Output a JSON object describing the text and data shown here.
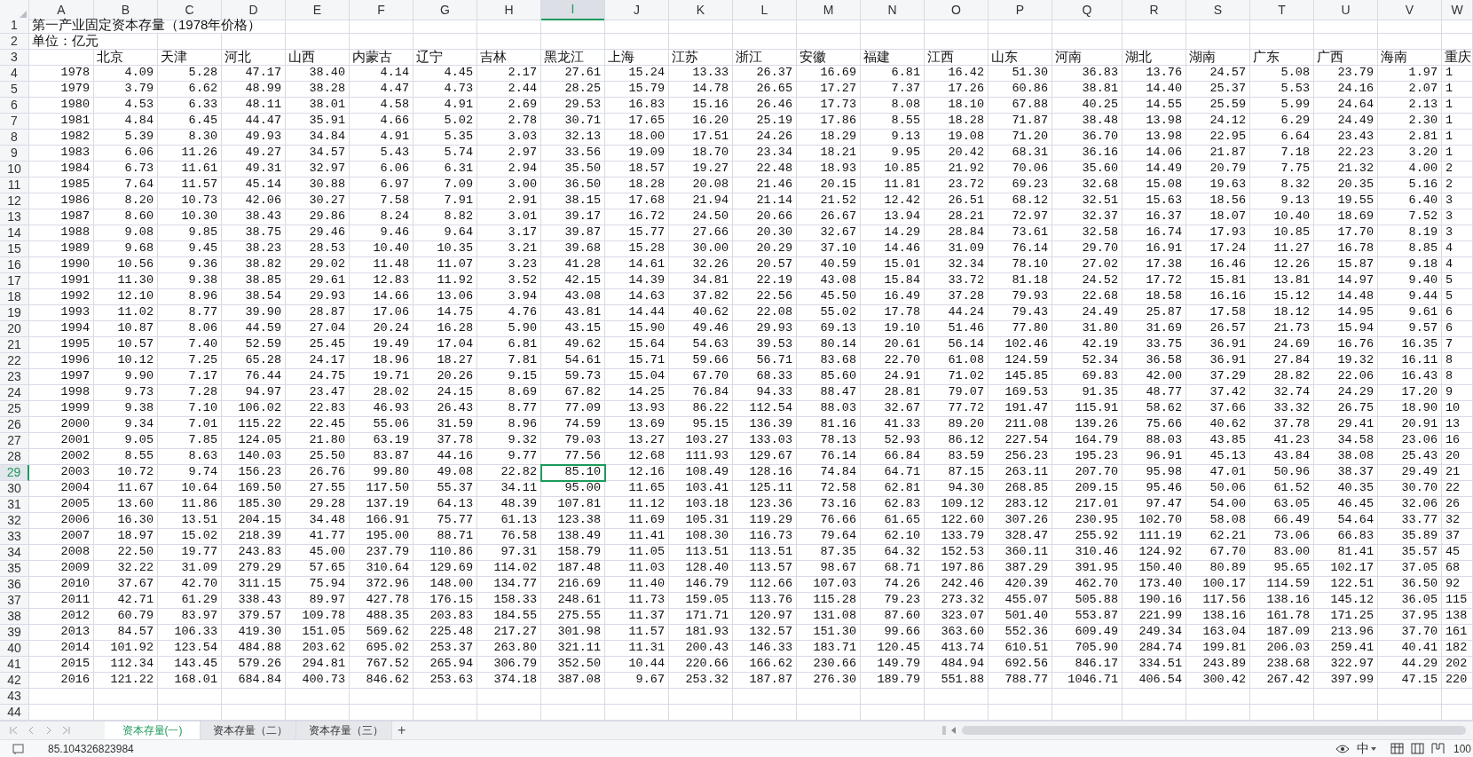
{
  "sheet": {
    "title": "第一产业固定资本存量（1978年价格）",
    "unit": "单位：亿元",
    "columns": [
      {
        "label": "A",
        "selected": false
      },
      {
        "label": "B",
        "selected": false
      },
      {
        "label": "C",
        "selected": false
      },
      {
        "label": "D",
        "selected": false
      },
      {
        "label": "E",
        "selected": false
      },
      {
        "label": "F",
        "selected": false
      },
      {
        "label": "G",
        "selected": false
      },
      {
        "label": "H",
        "selected": false
      },
      {
        "label": "I",
        "selected": true
      },
      {
        "label": "J",
        "selected": false
      },
      {
        "label": "K",
        "selected": false
      },
      {
        "label": "L",
        "selected": false
      },
      {
        "label": "M",
        "selected": false
      },
      {
        "label": "N",
        "selected": false
      },
      {
        "label": "O",
        "selected": false
      },
      {
        "label": "P",
        "selected": false
      },
      {
        "label": "Q",
        "selected": false
      },
      {
        "label": "R",
        "selected": false
      },
      {
        "label": "S",
        "selected": false
      },
      {
        "label": "T",
        "selected": false
      },
      {
        "label": "U",
        "selected": false
      },
      {
        "label": "V",
        "selected": false
      },
      {
        "label": "W",
        "selected": false
      }
    ],
    "row_headers": [
      {
        "label": "1",
        "selected": false
      },
      {
        "label": "2",
        "selected": false
      },
      {
        "label": "3",
        "selected": false
      },
      {
        "label": "4",
        "selected": false
      },
      {
        "label": "5",
        "selected": false
      },
      {
        "label": "6",
        "selected": false
      },
      {
        "label": "7",
        "selected": false
      },
      {
        "label": "8",
        "selected": false
      },
      {
        "label": "9",
        "selected": false
      },
      {
        "label": "10",
        "selected": false
      },
      {
        "label": "11",
        "selected": false
      },
      {
        "label": "12",
        "selected": false
      },
      {
        "label": "13",
        "selected": false
      },
      {
        "label": "14",
        "selected": false
      },
      {
        "label": "15",
        "selected": false
      },
      {
        "label": "16",
        "selected": false
      },
      {
        "label": "17",
        "selected": false
      },
      {
        "label": "18",
        "selected": false
      },
      {
        "label": "19",
        "selected": false
      },
      {
        "label": "20",
        "selected": false
      },
      {
        "label": "21",
        "selected": false
      },
      {
        "label": "22",
        "selected": false
      },
      {
        "label": "23",
        "selected": false
      },
      {
        "label": "24",
        "selected": false
      },
      {
        "label": "25",
        "selected": false
      },
      {
        "label": "26",
        "selected": false
      },
      {
        "label": "27",
        "selected": false
      },
      {
        "label": "28",
        "selected": false
      },
      {
        "label": "29",
        "selected": true
      },
      {
        "label": "30",
        "selected": false
      },
      {
        "label": "31",
        "selected": false
      },
      {
        "label": "32",
        "selected": false
      },
      {
        "label": "33",
        "selected": false
      },
      {
        "label": "34",
        "selected": false
      },
      {
        "label": "35",
        "selected": false
      },
      {
        "label": "36",
        "selected": false
      },
      {
        "label": "37",
        "selected": false
      },
      {
        "label": "38",
        "selected": false
      },
      {
        "label": "39",
        "selected": false
      },
      {
        "label": "40",
        "selected": false
      },
      {
        "label": "41",
        "selected": false
      },
      {
        "label": "42",
        "selected": false
      },
      {
        "label": "43",
        "selected": false
      },
      {
        "label": "44",
        "selected": false
      }
    ],
    "region_headers": [
      "北京",
      "天津",
      "河北",
      "山西",
      "内蒙古",
      "辽宁",
      "吉林",
      "黑龙江",
      "上海",
      "江苏",
      "浙江",
      "安徽",
      "福建",
      "江西",
      "山东",
      "河南",
      "湖北",
      "湖南",
      "广东",
      "广西",
      "海南",
      "重庆"
    ],
    "rows": [
      {
        "cells": [
          "1978",
          "4.09",
          "5.28",
          "47.17",
          "38.40",
          "4.14",
          "4.45",
          "2.17",
          "27.61",
          "15.24",
          "13.33",
          "26.37",
          "16.69",
          "6.81",
          "16.42",
          "51.30",
          "36.83",
          "13.76",
          "24.57",
          "5.08",
          "23.79",
          "1.97",
          "1"
        ]
      },
      {
        "cells": [
          "1979",
          "3.79",
          "6.62",
          "48.99",
          "38.28",
          "4.47",
          "4.73",
          "2.44",
          "28.25",
          "15.79",
          "14.78",
          "26.65",
          "17.27",
          "7.37",
          "17.26",
          "60.86",
          "38.81",
          "14.40",
          "25.37",
          "5.53",
          "24.16",
          "2.07",
          "1"
        ]
      },
      {
        "cells": [
          "1980",
          "4.53",
          "6.33",
          "48.11",
          "38.01",
          "4.58",
          "4.91",
          "2.69",
          "29.53",
          "16.83",
          "15.16",
          "26.46",
          "17.73",
          "8.08",
          "18.10",
          "67.88",
          "40.25",
          "14.55",
          "25.59",
          "5.99",
          "24.64",
          "2.13",
          "1"
        ]
      },
      {
        "cells": [
          "1981",
          "4.84",
          "6.45",
          "44.47",
          "35.91",
          "4.66",
          "5.02",
          "2.78",
          "30.71",
          "17.65",
          "16.20",
          "25.19",
          "17.86",
          "8.55",
          "18.28",
          "71.87",
          "38.48",
          "13.98",
          "24.12",
          "6.29",
          "24.49",
          "2.30",
          "1"
        ]
      },
      {
        "cells": [
          "1982",
          "5.39",
          "8.30",
          "49.93",
          "34.84",
          "4.91",
          "5.35",
          "3.03",
          "32.13",
          "18.00",
          "17.51",
          "24.26",
          "18.29",
          "9.13",
          "19.08",
          "71.20",
          "36.70",
          "13.98",
          "22.95",
          "6.64",
          "23.43",
          "2.81",
          "1"
        ]
      },
      {
        "cells": [
          "1983",
          "6.06",
          "11.26",
          "49.27",
          "34.57",
          "5.43",
          "5.74",
          "2.97",
          "33.56",
          "19.09",
          "18.70",
          "23.34",
          "18.21",
          "9.95",
          "20.42",
          "68.31",
          "36.16",
          "14.06",
          "21.87",
          "7.18",
          "22.23",
          "3.20",
          "1"
        ]
      },
      {
        "cells": [
          "1984",
          "6.73",
          "11.61",
          "49.31",
          "32.97",
          "6.06",
          "6.31",
          "2.94",
          "35.50",
          "18.57",
          "19.27",
          "22.48",
          "18.93",
          "10.85",
          "21.92",
          "70.06",
          "35.60",
          "14.49",
          "20.79",
          "7.75",
          "21.32",
          "4.00",
          "2"
        ]
      },
      {
        "cells": [
          "1985",
          "7.64",
          "11.57",
          "45.14",
          "30.88",
          "6.97",
          "7.09",
          "3.00",
          "36.50",
          "18.28",
          "20.08",
          "21.46",
          "20.15",
          "11.81",
          "23.72",
          "69.23",
          "32.68",
          "15.08",
          "19.63",
          "8.32",
          "20.35",
          "5.16",
          "2"
        ]
      },
      {
        "cells": [
          "1986",
          "8.20",
          "10.73",
          "42.06",
          "30.27",
          "7.58",
          "7.91",
          "2.91",
          "38.15",
          "17.68",
          "21.94",
          "21.14",
          "21.52",
          "12.42",
          "26.51",
          "68.12",
          "32.51",
          "15.63",
          "18.56",
          "9.13",
          "19.55",
          "6.40",
          "3"
        ]
      },
      {
        "cells": [
          "1987",
          "8.60",
          "10.30",
          "38.43",
          "29.86",
          "8.24",
          "8.82",
          "3.01",
          "39.17",
          "16.72",
          "24.50",
          "20.66",
          "26.67",
          "13.94",
          "28.21",
          "72.97",
          "32.37",
          "16.37",
          "18.07",
          "10.40",
          "18.69",
          "7.52",
          "3"
        ]
      },
      {
        "cells": [
          "1988",
          "9.08",
          "9.85",
          "38.75",
          "29.46",
          "9.46",
          "9.64",
          "3.17",
          "39.87",
          "15.77",
          "27.66",
          "20.30",
          "32.67",
          "14.29",
          "28.84",
          "73.61",
          "32.58",
          "16.74",
          "17.93",
          "10.85",
          "17.70",
          "8.19",
          "3"
        ]
      },
      {
        "cells": [
          "1989",
          "9.68",
          "9.45",
          "38.23",
          "28.53",
          "10.40",
          "10.35",
          "3.21",
          "39.68",
          "15.28",
          "30.00",
          "20.29",
          "37.10",
          "14.46",
          "31.09",
          "76.14",
          "29.70",
          "16.91",
          "17.24",
          "11.27",
          "16.78",
          "8.85",
          "4"
        ]
      },
      {
        "cells": [
          "1990",
          "10.56",
          "9.36",
          "38.82",
          "29.02",
          "11.48",
          "11.07",
          "3.23",
          "41.28",
          "14.61",
          "32.26",
          "20.57",
          "40.59",
          "15.01",
          "32.34",
          "78.10",
          "27.02",
          "17.38",
          "16.46",
          "12.26",
          "15.87",
          "9.18",
          "4"
        ]
      },
      {
        "cells": [
          "1991",
          "11.30",
          "9.38",
          "38.85",
          "29.61",
          "12.83",
          "11.92",
          "3.52",
          "42.15",
          "14.39",
          "34.81",
          "22.19",
          "43.08",
          "15.84",
          "33.72",
          "81.18",
          "24.52",
          "17.72",
          "15.81",
          "13.81",
          "14.97",
          "9.40",
          "5"
        ]
      },
      {
        "cells": [
          "1992",
          "12.10",
          "8.96",
          "38.54",
          "29.93",
          "14.66",
          "13.06",
          "3.94",
          "43.08",
          "14.63",
          "37.82",
          "22.56",
          "45.50",
          "16.49",
          "37.28",
          "79.93",
          "22.68",
          "18.58",
          "16.16",
          "15.12",
          "14.48",
          "9.44",
          "5"
        ]
      },
      {
        "cells": [
          "1993",
          "11.02",
          "8.77",
          "39.90",
          "28.87",
          "17.06",
          "14.75",
          "4.76",
          "43.81",
          "14.44",
          "40.62",
          "22.08",
          "55.02",
          "17.78",
          "44.24",
          "79.43",
          "24.49",
          "25.87",
          "17.58",
          "18.12",
          "14.95",
          "9.61",
          "6"
        ]
      },
      {
        "cells": [
          "1994",
          "10.87",
          "8.06",
          "44.59",
          "27.04",
          "20.24",
          "16.28",
          "5.90",
          "43.15",
          "15.90",
          "49.46",
          "29.93",
          "69.13",
          "19.10",
          "51.46",
          "77.80",
          "31.80",
          "31.69",
          "26.57",
          "21.73",
          "15.94",
          "9.57",
          "6"
        ]
      },
      {
        "cells": [
          "1995",
          "10.57",
          "7.40",
          "52.59",
          "25.45",
          "19.49",
          "17.04",
          "6.81",
          "49.62",
          "15.64",
          "54.63",
          "39.53",
          "80.14",
          "20.61",
          "56.14",
          "102.46",
          "42.19",
          "33.75",
          "36.91",
          "24.69",
          "16.76",
          "16.35",
          "7"
        ]
      },
      {
        "cells": [
          "1996",
          "10.12",
          "7.25",
          "65.28",
          "24.17",
          "18.96",
          "18.27",
          "7.81",
          "54.61",
          "15.71",
          "59.66",
          "56.71",
          "83.68",
          "22.70",
          "61.08",
          "124.59",
          "52.34",
          "36.58",
          "36.91",
          "27.84",
          "19.32",
          "16.11",
          "8"
        ]
      },
      {
        "cells": [
          "1997",
          "9.90",
          "7.17",
          "76.44",
          "24.75",
          "19.71",
          "20.26",
          "9.15",
          "59.73",
          "15.04",
          "67.70",
          "68.33",
          "85.60",
          "24.91",
          "71.02",
          "145.85",
          "69.83",
          "42.00",
          "37.29",
          "28.82",
          "22.06",
          "16.43",
          "8"
        ]
      },
      {
        "cells": [
          "1998",
          "9.73",
          "7.28",
          "94.97",
          "23.47",
          "28.02",
          "24.15",
          "8.69",
          "67.82",
          "14.25",
          "76.84",
          "94.33",
          "88.47",
          "28.81",
          "79.07",
          "169.53",
          "91.35",
          "48.77",
          "37.42",
          "32.74",
          "24.29",
          "17.20",
          "9"
        ]
      },
      {
        "cells": [
          "1999",
          "9.38",
          "7.10",
          "106.02",
          "22.83",
          "46.93",
          "26.43",
          "8.77",
          "77.09",
          "13.93",
          "86.22",
          "112.54",
          "88.03",
          "32.67",
          "77.72",
          "191.47",
          "115.91",
          "58.62",
          "37.66",
          "33.32",
          "26.75",
          "18.90",
          "10"
        ]
      },
      {
        "cells": [
          "2000",
          "9.34",
          "7.01",
          "115.22",
          "22.45",
          "55.06",
          "31.59",
          "8.96",
          "74.59",
          "13.69",
          "95.15",
          "136.39",
          "81.16",
          "41.33",
          "89.20",
          "211.08",
          "139.26",
          "75.66",
          "40.62",
          "37.78",
          "29.41",
          "20.91",
          "13"
        ]
      },
      {
        "cells": [
          "2001",
          "9.05",
          "7.85",
          "124.05",
          "21.80",
          "63.19",
          "37.78",
          "9.32",
          "79.03",
          "13.27",
          "103.27",
          "133.03",
          "78.13",
          "52.93",
          "86.12",
          "227.54",
          "164.79",
          "88.03",
          "43.85",
          "41.23",
          "34.58",
          "23.06",
          "16"
        ]
      },
      {
        "cells": [
          "2002",
          "8.55",
          "8.63",
          "140.03",
          "25.50",
          "83.87",
          "44.16",
          "9.77",
          "77.56",
          "12.68",
          "111.93",
          "129.67",
          "76.14",
          "66.84",
          "83.59",
          "256.23",
          "195.23",
          "96.91",
          "45.13",
          "43.84",
          "38.08",
          "25.43",
          "20"
        ]
      },
      {
        "cells": [
          "2003",
          "10.72",
          "9.74",
          "156.23",
          "26.76",
          "99.80",
          "49.08",
          "22.82",
          "85.10",
          "12.16",
          "108.49",
          "128.16",
          "74.84",
          "64.71",
          "87.15",
          "263.11",
          "207.70",
          "95.98",
          "47.01",
          "50.96",
          "38.37",
          "29.49",
          "21"
        ]
      },
      {
        "cells": [
          "2004",
          "11.67",
          "10.64",
          "169.50",
          "27.55",
          "117.50",
          "55.37",
          "34.11",
          "95.00",
          "11.65",
          "103.41",
          "125.11",
          "72.58",
          "62.81",
          "94.30",
          "268.85",
          "209.15",
          "95.46",
          "50.06",
          "61.52",
          "40.35",
          "30.70",
          "22"
        ]
      },
      {
        "cells": [
          "2005",
          "13.60",
          "11.86",
          "185.30",
          "29.28",
          "137.19",
          "64.13",
          "48.39",
          "107.81",
          "11.12",
          "103.18",
          "123.36",
          "73.16",
          "62.83",
          "109.12",
          "283.12",
          "217.01",
          "97.47",
          "54.00",
          "63.05",
          "46.45",
          "32.06",
          "26"
        ]
      },
      {
        "cells": [
          "2006",
          "16.30",
          "13.51",
          "204.15",
          "34.48",
          "166.91",
          "75.77",
          "61.13",
          "123.38",
          "11.69",
          "105.31",
          "119.29",
          "76.66",
          "61.65",
          "122.60",
          "307.26",
          "230.95",
          "102.70",
          "58.08",
          "66.49",
          "54.64",
          "33.77",
          "32"
        ]
      },
      {
        "cells": [
          "2007",
          "18.97",
          "15.02",
          "218.39",
          "41.77",
          "195.00",
          "88.71",
          "76.58",
          "138.49",
          "11.41",
          "108.30",
          "116.73",
          "79.64",
          "62.10",
          "133.79",
          "328.47",
          "255.92",
          "111.19",
          "62.21",
          "73.06",
          "66.83",
          "35.89",
          "37"
        ]
      },
      {
        "cells": [
          "2008",
          "22.50",
          "19.77",
          "243.83",
          "45.00",
          "237.79",
          "110.86",
          "97.31",
          "158.79",
          "11.05",
          "113.51",
          "113.51",
          "87.35",
          "64.32",
          "152.53",
          "360.11",
          "310.46",
          "124.92",
          "67.70",
          "83.00",
          "81.41",
          "35.57",
          "45"
        ]
      },
      {
        "cells": [
          "2009",
          "32.22",
          "31.09",
          "279.29",
          "57.65",
          "310.64",
          "129.69",
          "114.02",
          "187.48",
          "11.03",
          "128.40",
          "113.57",
          "98.67",
          "68.71",
          "197.86",
          "387.29",
          "391.95",
          "150.40",
          "80.89",
          "95.65",
          "102.17",
          "37.05",
          "68"
        ]
      },
      {
        "cells": [
          "2010",
          "37.67",
          "42.70",
          "311.15",
          "75.94",
          "372.96",
          "148.00",
          "134.77",
          "216.69",
          "11.40",
          "146.79",
          "112.66",
          "107.03",
          "74.26",
          "242.46",
          "420.39",
          "462.70",
          "173.40",
          "100.17",
          "114.59",
          "122.51",
          "36.50",
          "92"
        ]
      },
      {
        "cells": [
          "2011",
          "42.71",
          "61.29",
          "338.43",
          "89.97",
          "427.78",
          "176.15",
          "158.33",
          "248.61",
          "11.73",
          "159.05",
          "113.76",
          "115.28",
          "79.23",
          "273.32",
          "455.07",
          "505.88",
          "190.16",
          "117.56",
          "138.16",
          "145.12",
          "36.05",
          "115"
        ]
      },
      {
        "cells": [
          "2012",
          "60.79",
          "83.97",
          "379.57",
          "109.78",
          "488.35",
          "203.83",
          "184.55",
          "275.55",
          "11.37",
          "171.71",
          "120.97",
          "131.08",
          "87.60",
          "323.07",
          "501.40",
          "553.87",
          "221.99",
          "138.16",
          "161.78",
          "171.25",
          "37.95",
          "138"
        ]
      },
      {
        "cells": [
          "2013",
          "84.57",
          "106.33",
          "419.30",
          "151.05",
          "569.62",
          "225.48",
          "217.27",
          "301.98",
          "11.57",
          "181.93",
          "132.57",
          "151.30",
          "99.66",
          "363.60",
          "552.36",
          "609.49",
          "249.34",
          "163.04",
          "187.09",
          "213.96",
          "37.70",
          "161"
        ]
      },
      {
        "cells": [
          "2014",
          "101.92",
          "123.54",
          "484.88",
          "203.62",
          "695.02",
          "253.37",
          "263.80",
          "321.11",
          "11.31",
          "200.43",
          "146.33",
          "183.71",
          "120.45",
          "413.74",
          "610.51",
          "705.90",
          "284.74",
          "199.81",
          "206.03",
          "259.41",
          "40.41",
          "182"
        ]
      },
      {
        "cells": [
          "2015",
          "112.34",
          "143.45",
          "579.26",
          "294.81",
          "767.52",
          "265.94",
          "306.79",
          "352.50",
          "10.44",
          "220.66",
          "166.62",
          "230.66",
          "149.79",
          "484.94",
          "692.56",
          "846.17",
          "334.51",
          "243.89",
          "238.68",
          "322.97",
          "44.29",
          "202"
        ]
      },
      {
        "cells": [
          "2016",
          "121.22",
          "168.01",
          "684.84",
          "400.73",
          "846.62",
          "253.63",
          "374.18",
          "387.08",
          "9.67",
          "253.32",
          "187.87",
          "276.30",
          "189.79",
          "551.88",
          "788.77",
          "1046.71",
          "406.54",
          "300.42",
          "267.42",
          "397.99",
          "47.15",
          "220"
        ]
      }
    ]
  },
  "sheet_tabs": [
    {
      "label": "资本存量(一)",
      "selected": true
    },
    {
      "label": "资本存量（二）",
      "selected": false
    },
    {
      "label": "资本存量（三）",
      "selected": false
    }
  ],
  "add_sheet": "+",
  "status_bar": {
    "value": "85.104326823984",
    "input_method": "中",
    "zoom": "100"
  }
}
